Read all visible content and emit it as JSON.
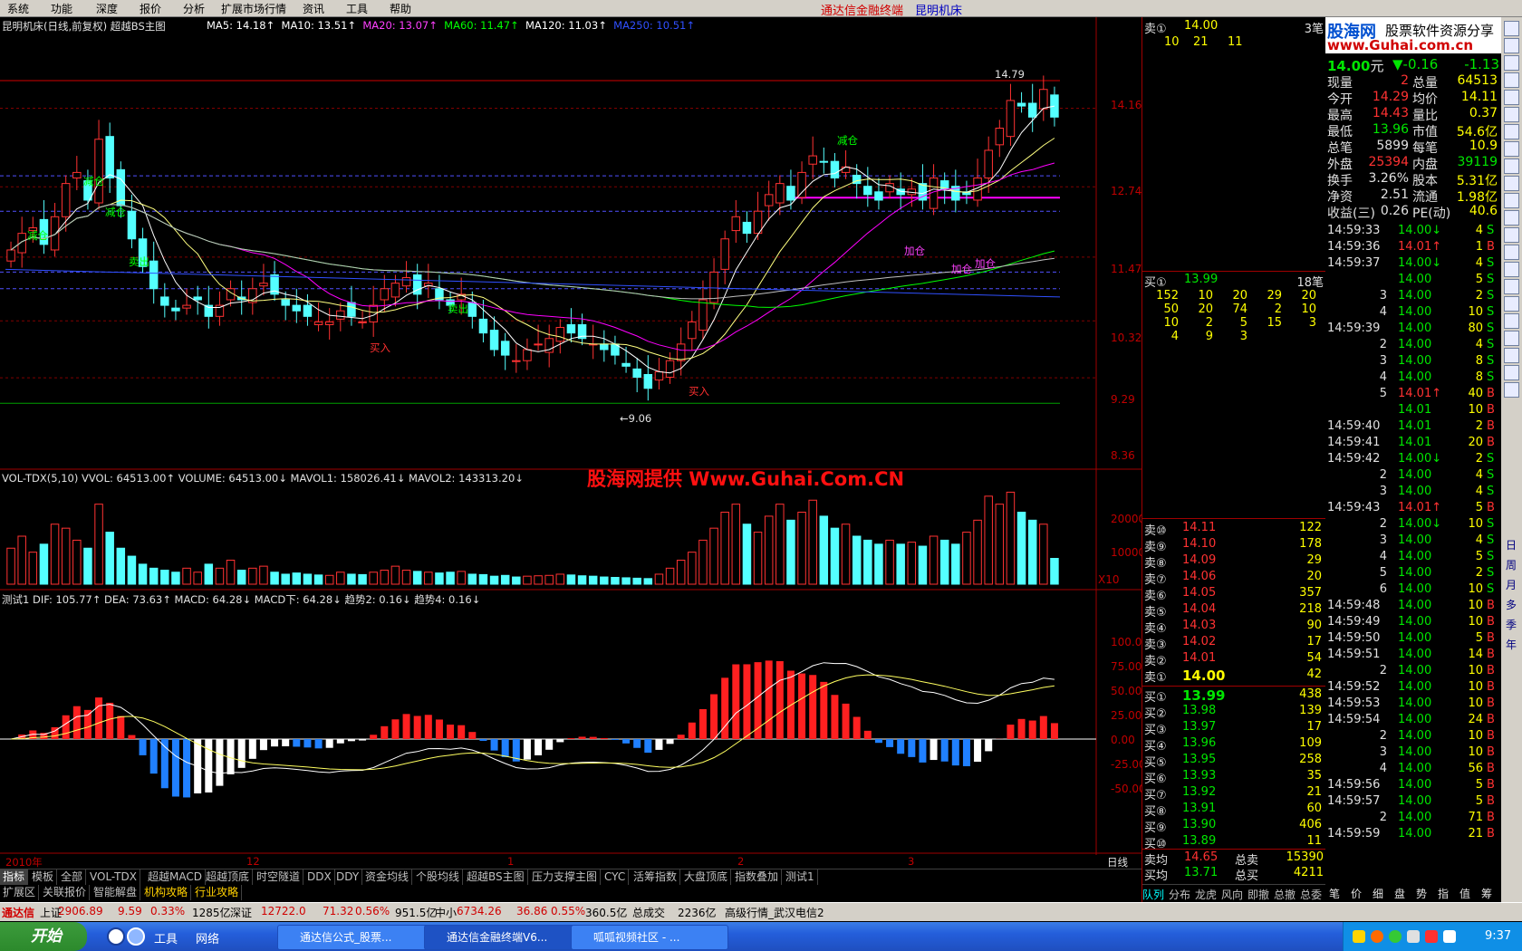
{
  "menu": [
    "系统",
    "功能",
    "深度",
    "报价",
    "分析",
    "扩展市场行情",
    "资讯",
    "工具",
    "帮助"
  ],
  "app_title": "通达信金融终端",
  "stock_title": "昆明机床",
  "chart": {
    "header_main": "昆明机床(日线,前复权) 超越BS主图",
    "ma": [
      {
        "label": "MA5: 14.18↑",
        "color": "#ffffff"
      },
      {
        "label": "MA10: 13.51↑",
        "color": "#ffffff"
      },
      {
        "label": "MA20: 13.07↑",
        "color": "#ff00ff"
      },
      {
        "label": "MA60: 11.47↑",
        "color": "#00ff00"
      },
      {
        "label": "MA120: 11.03↑",
        "color": "#ffffff"
      },
      {
        "label": "MA250: 10.51↑",
        "color": "#0000ff"
      }
    ],
    "price_ticks": [
      "14.16",
      "12.74",
      "11.47",
      "10.32",
      "9.29",
      "8.36"
    ],
    "high_label": "14.79",
    "low_label": "←9.06",
    "signals": [
      "减仓",
      "减仓",
      "减仓",
      "卖出",
      "卖出",
      "买入",
      "买入",
      "减仓",
      "加仓",
      "加仓",
      "加仓"
    ],
    "watermark": "股海网提供 Www.Guhai.Com.CN",
    "vol_header": "VOL-TDX(5,10)  VVOL: 64513.00↑  VOLUME: 64513.00↓  MAVOL1: 158026.41↓  MAVOL2: 143313.20↓",
    "vol_ticks": [
      "20000",
      "10000",
      "X10"
    ],
    "macd_header": "测试1  DIF: 105.77↑  DEA: 73.63↑  MACD: 64.28↓  MACD下: 64.28↓  趋势2: 0.16↓  趋势4: 0.16↓",
    "macd_ticks": [
      "100.0",
      "75.00",
      "50.00",
      "25.00",
      "0.00",
      "-25.00",
      "-50.00"
    ],
    "date_labels": [
      "2010年",
      "12",
      "1",
      "2",
      "3"
    ],
    "period": "日线"
  },
  "tabs1": [
    "指标",
    "模板",
    "全部",
    "VOL-TDX",
    "超越MACD",
    "超越顶底",
    "时空隧道",
    "DDX",
    "DDY",
    "资金均线",
    "个股均线",
    "超越BS主图",
    "压力支撑主图",
    "CYC",
    "活筹指数",
    "大盘顶底",
    "指数叠加",
    "测试1"
  ],
  "tabs2": [
    "扩展区",
    "关联报价",
    "智能解盘",
    "机构攻略",
    "行业攻略"
  ],
  "quote": {
    "sell1_head": {
      "label": "卖①",
      "price": "14.00",
      "count": "3笔"
    },
    "sell1_q": [
      "10",
      "21",
      "11"
    ],
    "buy1_head": {
      "label": "买①",
      "price": "13.99",
      "count": "18笔"
    },
    "buy1_q": [
      [
        "152",
        "10",
        "20",
        "29",
        "20"
      ],
      [
        "50",
        "20",
        "74",
        "2",
        "10"
      ],
      [
        "10",
        "2",
        "5",
        "15",
        "3"
      ],
      [
        "4",
        "9",
        "3"
      ]
    ],
    "sells": [
      {
        "l": "卖⑩",
        "p": "14.11",
        "v": "122"
      },
      {
        "l": "卖⑨",
        "p": "14.10",
        "v": "178"
      },
      {
        "l": "卖⑧",
        "p": "14.09",
        "v": "29"
      },
      {
        "l": "卖⑦",
        "p": "14.06",
        "v": "20"
      },
      {
        "l": "卖⑥",
        "p": "14.05",
        "v": "357"
      },
      {
        "l": "卖⑤",
        "p": "14.04",
        "v": "218"
      },
      {
        "l": "卖④",
        "p": "14.03",
        "v": "90"
      },
      {
        "l": "卖③",
        "p": "14.02",
        "v": "17"
      },
      {
        "l": "卖②",
        "p": "14.01",
        "v": "54"
      },
      {
        "l": "卖①",
        "p": "14.00",
        "v": "42"
      }
    ],
    "buys": [
      {
        "l": "买①",
        "p": "13.99",
        "v": "438"
      },
      {
        "l": "买②",
        "p": "13.98",
        "v": "139"
      },
      {
        "l": "买③",
        "p": "13.97",
        "v": "17"
      },
      {
        "l": "买④",
        "p": "13.96",
        "v": "109"
      },
      {
        "l": "买⑤",
        "p": "13.95",
        "v": "258"
      },
      {
        "l": "买⑥",
        "p": "13.93",
        "v": "35"
      },
      {
        "l": "买⑦",
        "p": "13.92",
        "v": "21"
      },
      {
        "l": "买⑧",
        "p": "13.91",
        "v": "60"
      },
      {
        "l": "买⑨",
        "p": "13.90",
        "v": "406"
      },
      {
        "l": "买⑩",
        "p": "13.89",
        "v": "11"
      }
    ],
    "avg_sell": {
      "l": "卖均",
      "p": "14.65",
      "l2": "总卖",
      "v": "15390"
    },
    "avg_buy": {
      "l": "买均",
      "p": "13.71",
      "l2": "总买",
      "v": "4211"
    },
    "bottom_tabs": [
      "队列",
      "分布",
      "龙虎",
      "风向",
      "即撤",
      "总撤",
      "总委"
    ]
  },
  "info": {
    "logo": "股海网",
    "logo_sub": "股票软件资源分享",
    "site": "www.Guhai.com.cn",
    "price": "14.00",
    "unit": "元",
    "change": "▼-0.16",
    "change_pct": "-1.13",
    "rows": [
      [
        "现量",
        "2",
        "总量",
        "64513"
      ],
      [
        "今开",
        "14.29",
        "均价",
        "14.11"
      ],
      [
        "最高",
        "14.43",
        "量比",
        "0.37"
      ],
      [
        "最低",
        "13.96",
        "市值",
        "54.6亿"
      ],
      [
        "总笔",
        "5899",
        "每笔",
        "10.9"
      ],
      [
        "外盘",
        "25394",
        "内盘",
        "39119"
      ],
      [
        "换手",
        "3.26%",
        "股本",
        "5.31亿"
      ],
      [
        "净资",
        "2.51",
        "流通",
        "1.98亿"
      ],
      [
        "收益(三)",
        "0.26",
        "PE(动)",
        "40.6"
      ]
    ],
    "ticks": [
      [
        "14:59:33",
        "14.00↓",
        "4",
        "S"
      ],
      [
        "14:59:36",
        "14.01↑",
        "1",
        "B"
      ],
      [
        "14:59:37",
        "14.00↓",
        "4",
        "S"
      ],
      [
        "",
        "14.00",
        "5",
        "S"
      ],
      [
        "3",
        "14.00",
        "2",
        "S"
      ],
      [
        "4",
        "14.00",
        "10",
        "S"
      ],
      [
        "14:59:39",
        "14.00",
        "80",
        "S"
      ],
      [
        "2",
        "14.00",
        "4",
        "S"
      ],
      [
        "3",
        "14.00",
        "8",
        "S"
      ],
      [
        "4",
        "14.00",
        "8",
        "S"
      ],
      [
        "5",
        "14.01↑",
        "40",
        "B"
      ],
      [
        "",
        "14.01",
        "10",
        "B"
      ],
      [
        "14:59:40",
        "14.01",
        "2",
        "B"
      ],
      [
        "14:59:41",
        "14.01",
        "20",
        "B"
      ],
      [
        "14:59:42",
        "14.00↓",
        "2",
        "S"
      ],
      [
        "2",
        "14.00",
        "4",
        "S"
      ],
      [
        "3",
        "14.00",
        "4",
        "S"
      ],
      [
        "14:59:43",
        "14.01↑",
        "5",
        "B"
      ],
      [
        "2",
        "14.00↓",
        "10",
        "S"
      ],
      [
        "3",
        "14.00",
        "4",
        "S"
      ],
      [
        "4",
        "14.00",
        "5",
        "S"
      ],
      [
        "5",
        "14.00",
        "2",
        "S"
      ],
      [
        "6",
        "14.00",
        "10",
        "S"
      ],
      [
        "14:59:48",
        "14.00",
        "10",
        "B"
      ],
      [
        "14:59:49",
        "14.00",
        "10",
        "B"
      ],
      [
        "14:59:50",
        "14.00",
        "5",
        "B"
      ],
      [
        "14:59:51",
        "14.00",
        "14",
        "B"
      ],
      [
        "2",
        "14.00",
        "10",
        "B"
      ],
      [
        "14:59:52",
        "14.00",
        "10",
        "B"
      ],
      [
        "14:59:53",
        "14.00",
        "10",
        "B"
      ],
      [
        "14:59:54",
        "14.00",
        "24",
        "B"
      ],
      [
        "2",
        "14.00",
        "10",
        "B"
      ],
      [
        "3",
        "14.00",
        "10",
        "B"
      ],
      [
        "4",
        "14.00",
        "56",
        "B"
      ],
      [
        "14:59:56",
        "14.00",
        "5",
        "B"
      ],
      [
        "14:59:57",
        "14.00",
        "5",
        "B"
      ],
      [
        "2",
        "14.00",
        "71",
        "B"
      ],
      [
        "14:59:59",
        "14.00",
        "21",
        "B"
      ]
    ],
    "right_tabs": [
      "笔",
      "价",
      "细",
      "盘",
      "势",
      "指",
      "值",
      "筹"
    ],
    "side_labels": [
      "日",
      "周",
      "月",
      "多",
      "季",
      "年"
    ]
  },
  "status": {
    "items": [
      "通达信",
      "上证",
      "2906.89",
      "9.59",
      "0.33%",
      "1285亿",
      "深证",
      "12722.0",
      "71.32",
      "0.56%",
      "951.5亿",
      "中小",
      "6734.26",
      "36.86",
      "0.55%",
      "360.5亿",
      "总成交",
      "2236亿",
      "高级行情_武汉电信2"
    ]
  },
  "taskbar": {
    "start": "开始",
    "quick": [
      "工具",
      "网络"
    ],
    "tasks": [
      "通达信公式_股票...",
      "通达信金融终端V6...",
      "呱呱视频社区 - ..."
    ],
    "time": "9:37"
  },
  "chart_data": {
    "type": "candlestick",
    "title": "昆明机床(日线,前复权) 超越BS主图",
    "ylim": [
      8.36,
      14.79
    ],
    "candles_close": [
      11.6,
      11.9,
      12.0,
      11.7,
      12.2,
      12.8,
      13.0,
      12.5,
      13.6,
      12.9,
      12.4,
      11.8,
      11.3,
      10.9,
      10.6,
      10.5,
      10.6,
      10.7,
      10.4,
      10.6,
      10.9,
      10.7,
      10.9,
      11.0,
      10.8,
      10.6,
      10.5,
      10.4,
      10.3,
      10.3,
      10.5,
      10.4,
      10.3,
      10.6,
      10.9,
      11.0,
      11.1,
      10.8,
      11.0,
      10.7,
      10.6,
      10.8,
      10.4,
      10.1,
      9.8,
      9.7,
      9.6,
      9.8,
      9.9,
      10.0,
      10.2,
      10.1,
      10.0,
      9.9,
      9.8,
      9.7,
      9.5,
      9.3,
      9.1,
      9.4,
      9.6,
      9.9,
      10.3,
      10.7,
      11.2,
      11.8,
      12.2,
      11.9,
      12.3,
      12.6,
      12.8,
      12.5,
      13.0,
      13.3,
      13.2,
      12.9,
      13.1,
      12.8,
      12.6,
      12.5,
      12.8,
      12.6,
      12.7,
      12.5,
      12.9,
      12.7,
      12.5,
      12.6,
      12.9,
      13.4,
      13.8,
      14.3,
      14.2,
      14.0,
      14.5,
      14.0
    ],
    "volume": [
      9000,
      12000,
      8000,
      10000,
      15000,
      14000,
      11000,
      9000,
      20000,
      13000,
      9000,
      7000,
      5000,
      4000,
      3500,
      3000,
      4000,
      3000,
      5000,
      4000,
      6000,
      3500,
      4000,
      4500,
      3000,
      2500,
      2800,
      2500,
      2300,
      2200,
      3000,
      2500,
      2400,
      3000,
      3500,
      4500,
      3500,
      3200,
      3000,
      2800,
      3000,
      3200,
      2500,
      2400,
      2000,
      2200,
      1800,
      2000,
      2100,
      2200,
      2500,
      2300,
      2100,
      2000,
      1800,
      1700,
      1600,
      1500,
      1400,
      2500,
      4000,
      6000,
      8000,
      11000,
      14000,
      18000,
      20000,
      15000,
      13000,
      17000,
      20000,
      16000,
      18000,
      21000,
      17000,
      14000,
      15000,
      12000,
      11000,
      10000,
      11000,
      10000,
      10500,
      9500,
      12000,
      11000,
      10000,
      13000,
      16000,
      22000,
      20000,
      23000,
      18000,
      16000,
      15000,
      6451
    ]
  }
}
